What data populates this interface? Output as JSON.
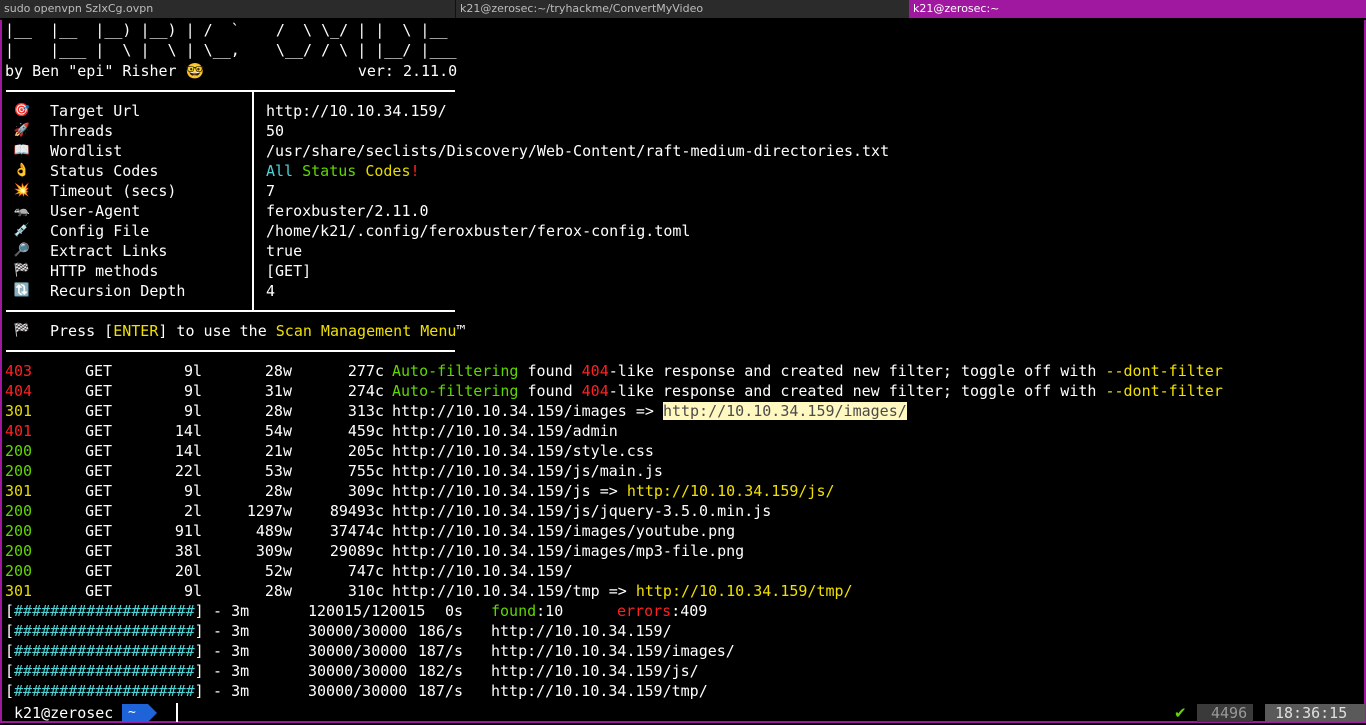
{
  "tabs": [
    {
      "label": "sudo openvpn SzIxCg.ovpn"
    },
    {
      "label": "k21@zerosec:~/tryhackme/ConvertMyVideo"
    },
    {
      "label": "k21@zerosec:~"
    }
  ],
  "banner": {
    "art_line1": "|__  |__  |__) |__) | /  `    /  \\ \\_/ | |  \\ |__",
    "art_line2": "|    |___ |  \\ |  \\ | \\__,    \\__/ / \\ | |__/ |___",
    "author": "by Ben \"epi\" Risher 🤓                 ver: 2.11.0"
  },
  "config": [
    {
      "icon": "🎯",
      "icon_name": "target-icon",
      "label": "Target Url",
      "value": "http://10.10.34.159/"
    },
    {
      "icon": "🚀",
      "icon_name": "rocket-icon",
      "label": "Threads",
      "value": "50"
    },
    {
      "icon": "📖",
      "icon_name": "book-icon",
      "label": "Wordlist",
      "value": "/usr/share/seclists/Discovery/Web-Content/raft-medium-directories.txt"
    },
    {
      "icon": "👌",
      "icon_name": "ok-hand-icon",
      "label": "Status Codes",
      "value_parts": [
        "All",
        "Status",
        "Codes",
        "!"
      ]
    },
    {
      "icon": "💥",
      "icon_name": "collision-icon",
      "label": "Timeout (secs)",
      "value": "7"
    },
    {
      "icon": "🦡",
      "icon_name": "badger-icon",
      "label": "User-Agent",
      "value": "feroxbuster/2.11.0"
    },
    {
      "icon": "💉",
      "icon_name": "syringe-icon",
      "label": "Config File",
      "value": "/home/k21/.config/feroxbuster/ferox-config.toml"
    },
    {
      "icon": "🔎",
      "icon_name": "magnifier-icon",
      "label": "Extract Links",
      "value": "true"
    },
    {
      "icon": "🏁",
      "icon_name": "checkered-flag-icon",
      "label": "HTTP methods",
      "value": "[GET]"
    },
    {
      "icon": "🔃",
      "icon_name": "recursion-icon",
      "label": "Recursion Depth",
      "value": "4"
    }
  ],
  "press": {
    "icon": "🏁",
    "pre": "Press [",
    "key": "ENTER",
    "mid": "] to use the ",
    "menu": "Scan Management Menu",
    "tm": "™"
  },
  "results": [
    {
      "status": "403",
      "color": "#ff2020",
      "method": "GET",
      "lines": "9l",
      "words": "28w",
      "chars": "277c",
      "kind": "filter",
      "prefix": "Auto-filtering",
      "found": " found ",
      "code": "404",
      "rest": "-like response and created new filter; toggle off with ",
      "flag": "--dont-filter"
    },
    {
      "status": "404",
      "color": "#ff2020",
      "method": "GET",
      "lines": "9l",
      "words": "31w",
      "chars": "274c",
      "kind": "filter",
      "prefix": "Auto-filtering",
      "found": " found ",
      "code": "404",
      "rest": "-like response and created new filter; toggle off with ",
      "flag": "--dont-filter"
    },
    {
      "status": "301",
      "color": "#e6db00",
      "method": "GET",
      "lines": "9l",
      "words": "28w",
      "chars": "313c",
      "kind": "redirect",
      "url": "http://10.10.34.159/images",
      "arrow": " => ",
      "target": "http://10.10.34.159/images/",
      "highlight": true
    },
    {
      "status": "401",
      "color": "#ff2020",
      "method": "GET",
      "lines": "14l",
      "words": "54w",
      "chars": "459c",
      "kind": "url",
      "url": "http://10.10.34.159/admin"
    },
    {
      "status": "200",
      "color": "#5fd700",
      "method": "GET",
      "lines": "14l",
      "words": "21w",
      "chars": "205c",
      "kind": "url",
      "url": "http://10.10.34.159/style.css"
    },
    {
      "status": "200",
      "color": "#5fd700",
      "method": "GET",
      "lines": "22l",
      "words": "53w",
      "chars": "755c",
      "kind": "url",
      "url": "http://10.10.34.159/js/main.js"
    },
    {
      "status": "301",
      "color": "#e6db00",
      "method": "GET",
      "lines": "9l",
      "words": "28w",
      "chars": "309c",
      "kind": "redirect",
      "url": "http://10.10.34.159/js",
      "arrow": " => ",
      "target": "http://10.10.34.159/js/",
      "highlight": false
    },
    {
      "status": "200",
      "color": "#5fd700",
      "method": "GET",
      "lines": "2l",
      "words": "1297w",
      "chars": "89493c",
      "kind": "url",
      "url": "http://10.10.34.159/js/jquery-3.5.0.min.js"
    },
    {
      "status": "200",
      "color": "#5fd700",
      "method": "GET",
      "lines": "91l",
      "words": "489w",
      "chars": "37474c",
      "kind": "url",
      "url": "http://10.10.34.159/images/youtube.png"
    },
    {
      "status": "200",
      "color": "#5fd700",
      "method": "GET",
      "lines": "38l",
      "words": "309w",
      "chars": "29089c",
      "kind": "url",
      "url": "http://10.10.34.159/images/mp3-file.png"
    },
    {
      "status": "200",
      "color": "#5fd700",
      "method": "GET",
      "lines": "20l",
      "words": "52w",
      "chars": "747c",
      "kind": "url",
      "url": "http://10.10.34.159/"
    },
    {
      "status": "301",
      "color": "#e6db00",
      "method": "GET",
      "lines": "9l",
      "words": "28w",
      "chars": "310c",
      "kind": "redirect",
      "url": "http://10.10.34.159/tmp",
      "arrow": " => ",
      "target": "http://10.10.34.159/tmp/",
      "highlight": false
    }
  ],
  "progress": [
    {
      "bar": "[####################]",
      "time": " - 3m ",
      "count": "120015/120015",
      "rate": "0s",
      "found_label": "found",
      "found": ":10",
      "errors_label": "errors",
      "errors": ":409"
    },
    {
      "bar": "[####################]",
      "time": " - 3m ",
      "count": "30000/30000",
      "rate": "186/s",
      "url": "http://10.10.34.159/"
    },
    {
      "bar": "[####################]",
      "time": " - 3m ",
      "count": "30000/30000",
      "rate": "187/s",
      "url": "http://10.10.34.159/images/"
    },
    {
      "bar": "[####################]",
      "time": " - 3m ",
      "count": "30000/30000",
      "rate": "182/s",
      "url": "http://10.10.34.159/js/"
    },
    {
      "bar": "[####################]",
      "time": " - 3m ",
      "count": "30000/30000",
      "rate": "187/s",
      "url": "http://10.10.34.159/tmp/"
    }
  ],
  "prompt": {
    "user": "k21@zerosec",
    "dir": "~",
    "check": "✔",
    "history": "4496",
    "time": "18:36:15"
  }
}
